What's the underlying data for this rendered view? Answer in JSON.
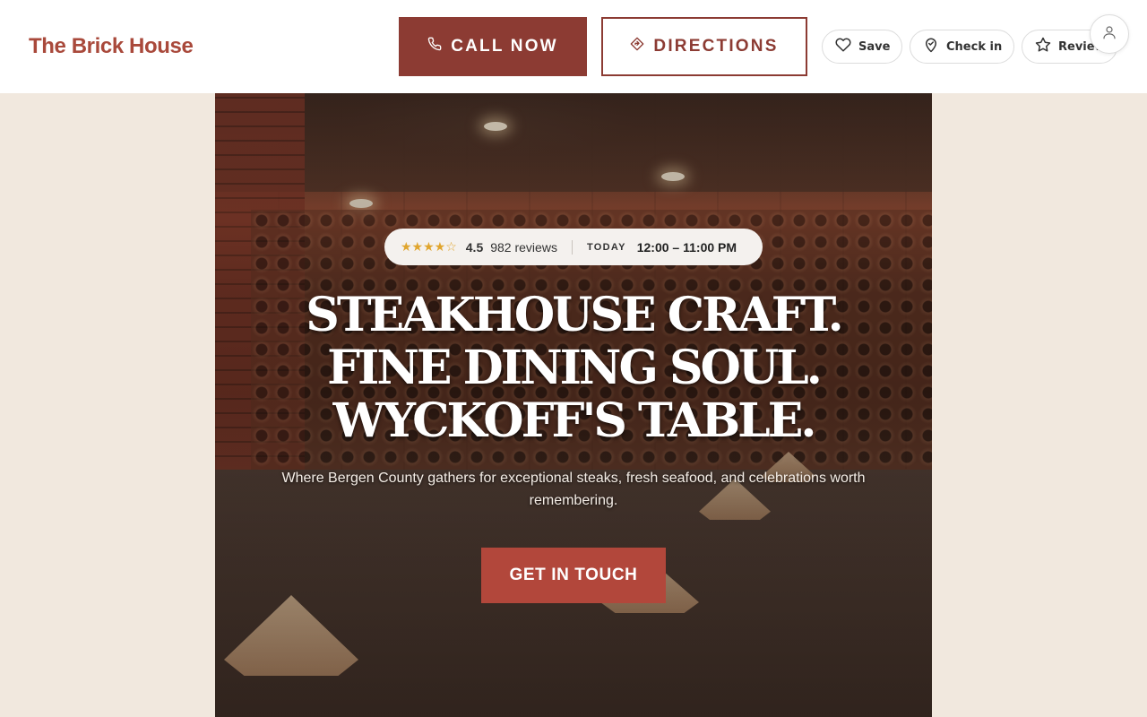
{
  "brand": {
    "name": "The Brick House",
    "color": "#a9493b"
  },
  "header": {
    "call_label": "CALL NOW",
    "call_icon": "phone-icon",
    "directions_label": "DIRECTIONS",
    "directions_icon": "directions-icon",
    "actions": [
      {
        "label": "Save",
        "icon": "heart-icon"
      },
      {
        "label": "Check in",
        "icon": "map-pin-icon"
      },
      {
        "label": "Review",
        "icon": "star-outline-icon"
      }
    ],
    "account_icon": "user-icon"
  },
  "hero": {
    "rating": {
      "stars": "★★★★☆",
      "value": "4.5",
      "reviews": "982 reviews",
      "today_label": "TODAY",
      "hours": "12:00 – 11:00 PM"
    },
    "headline": [
      "STEAKHOUSE CRAFT.",
      "FINE DINING SOUL.",
      "WYCKOFF'S TABLE."
    ],
    "subtext": "Where Bergen County gathers for exceptional steaks, fresh seafood, and celebrations worth remembering.",
    "cta_label": "GET IN TOUCH"
  },
  "colors": {
    "primary": "#8c3b33",
    "accent": "#b2473b",
    "page_bg": "#f1e8de",
    "star": "#e0a52d"
  }
}
